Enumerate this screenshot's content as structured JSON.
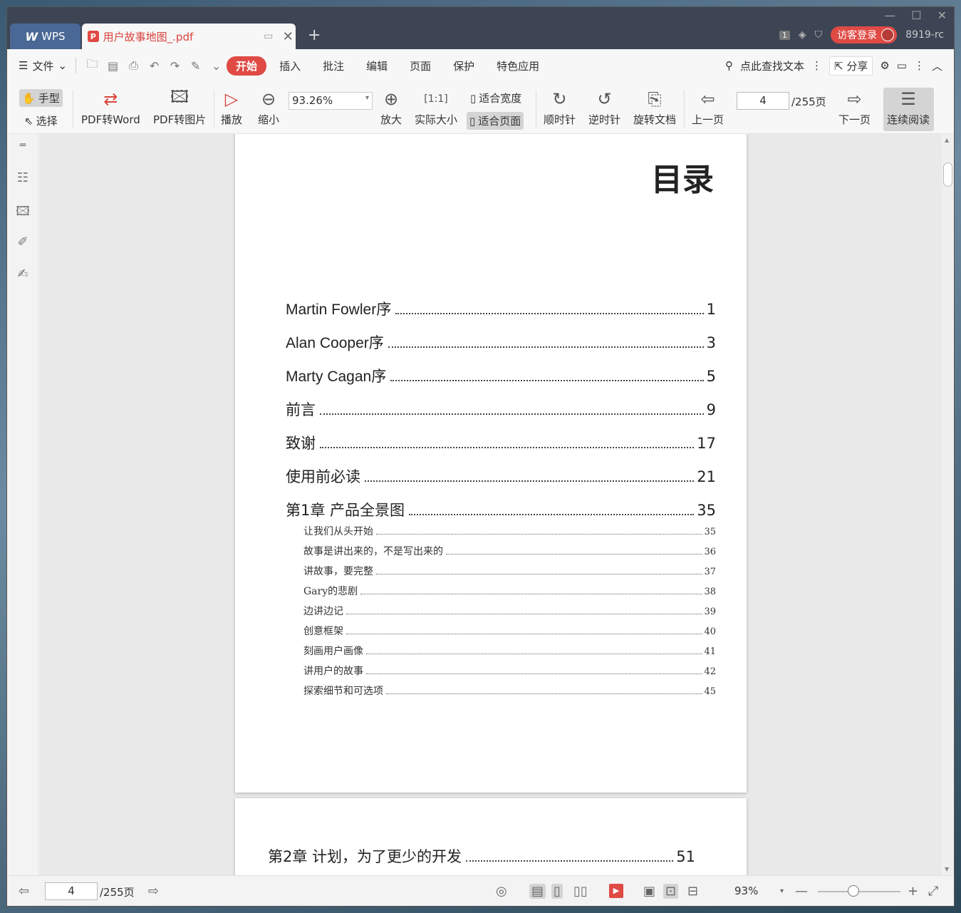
{
  "titlebar": {
    "app_tab": "WPS",
    "doc_tab": "用户故事地图_.pdf",
    "login": "访客登录",
    "version": "8919-rc",
    "badge": "1"
  },
  "menubar": {
    "file": "文件",
    "tabs": [
      "开始",
      "插入",
      "批注",
      "编辑",
      "页面",
      "保护",
      "特色应用"
    ],
    "search": "点此查找文本",
    "share": "分享"
  },
  "ribbon": {
    "hand": "手型",
    "select": "选择",
    "pdf_to_word": "PDF转Word",
    "pdf_to_image": "PDF转图片",
    "play": "播放",
    "zoom_out": "缩小",
    "zoom_value": "93.26%",
    "zoom_in": "放大",
    "actual_size": "实际大小",
    "fit_width": "适合宽度",
    "fit_page": "适合页面",
    "clockwise": "顺时针",
    "counter_clockwise": "逆时针",
    "rotate_doc": "旋转文档",
    "prev_page": "上一页",
    "page_value": "4",
    "page_total": "/255页",
    "next_page": "下一页",
    "continuous": "连续阅读"
  },
  "document": {
    "toc_title": "目录",
    "chapters": [
      {
        "label": "Martin Fowler序",
        "page": "1"
      },
      {
        "label": "Alan Cooper序",
        "page": "3"
      },
      {
        "label": "Marty Cagan序",
        "page": "5"
      },
      {
        "label": "前言",
        "page": "9"
      },
      {
        "label": "致谢",
        "page": "17"
      },
      {
        "label": "使用前必读",
        "page": "21"
      },
      {
        "label": "第1章 产品全景图",
        "page": "35"
      }
    ],
    "sections": [
      {
        "label": "让我们从头开始",
        "page": "35"
      },
      {
        "label": "故事是讲出来的，不是写出来的",
        "page": "36"
      },
      {
        "label": "讲故事，要完整",
        "page": "37"
      },
      {
        "label": "Gary的悲剧",
        "page": "38"
      },
      {
        "label": "边讲边记",
        "page": "39"
      },
      {
        "label": "创意框架",
        "page": "40"
      },
      {
        "label": "刻画用户画像",
        "page": "41"
      },
      {
        "label": "讲用户的故事",
        "page": "42"
      },
      {
        "label": "探索细节和可选项",
        "page": "45"
      }
    ],
    "next_page_chapter": {
      "label": "第2章 计划，为了更少的开发",
      "page": "51"
    }
  },
  "statusbar": {
    "page_value": "4",
    "page_total": "/255页",
    "zoom": "93%"
  }
}
